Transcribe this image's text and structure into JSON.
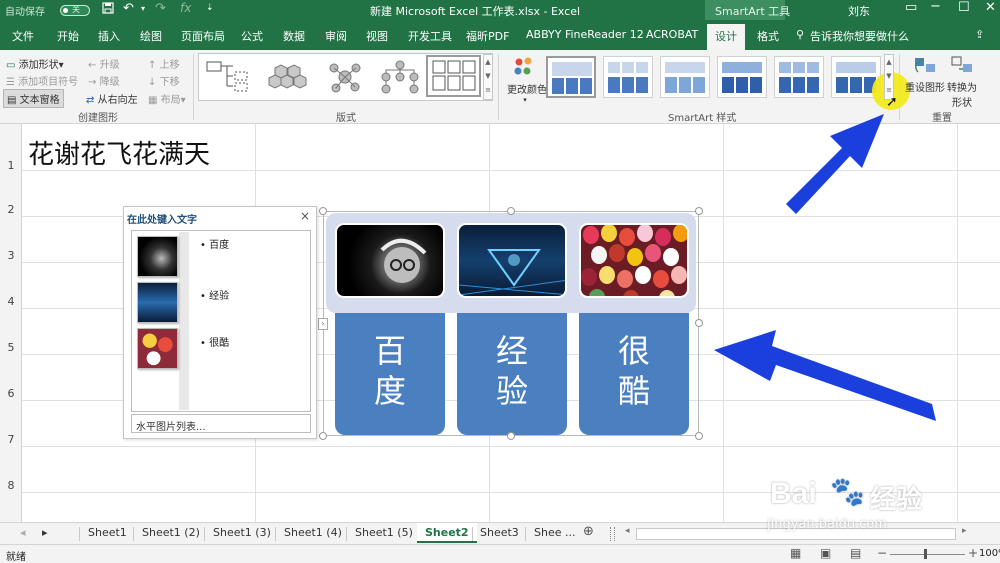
{
  "titlebar": {
    "autosave_label": "自动保存",
    "autosave_state": "关",
    "document_title": "新建 Microsoft Excel 工作表.xlsx  -  Excel",
    "contextual_tool": "SmartArt 工具",
    "user_name": "刘东",
    "qa_fx": "fx"
  },
  "tabs": [
    "文件",
    "开始",
    "插入",
    "绘图",
    "页面布局",
    "公式",
    "数据",
    "审阅",
    "视图",
    "开发工具",
    "福昕PDF",
    "ABBYY FineReader 12",
    "ACROBAT",
    "设计",
    "格式"
  ],
  "tell_me": "告诉我你想要做什么",
  "ribbon": {
    "create_graphic": {
      "label": "创建图形",
      "add_shape": "添加形状",
      "add_bullet": "添加项目符号",
      "text_pane": "文本窗格",
      "promote": "升级",
      "demote": "降级",
      "right_to_left": "从右向左",
      "move_up": "上移",
      "move_down": "下移",
      "layout": "布局"
    },
    "layouts_label": "版式",
    "change_colors": "更改颜色",
    "styles_label": "SmartArt 样式",
    "reset": {
      "label": "重置",
      "reset_graphic": "重设图形",
      "convert_line1": "转换为",
      "convert_line2": "形状"
    }
  },
  "sheet": {
    "row_numbers": [
      "1",
      "2",
      "3",
      "4",
      "5",
      "6",
      "7",
      "8"
    ],
    "a1_text": "花谢花飞花满天"
  },
  "text_pane": {
    "title": "在此处键入文字",
    "close": "×",
    "items": [
      "百度",
      "经验",
      "很酷"
    ],
    "footer": "水平图片列表..."
  },
  "smartart": {
    "labels_line1": [
      "百",
      "经",
      "很"
    ],
    "labels_line2": [
      "度",
      "验",
      "酷"
    ]
  },
  "sheet_tabs": [
    "Sheet1",
    "Sheet1 (2)",
    "Sheet1 (3)",
    "Sheet1 (4)",
    "Sheet1 (5)",
    "Sheet2",
    "Sheet3",
    "Shee ..."
  ],
  "active_sheet": "Sheet2",
  "status": {
    "ready": "就绪",
    "zoom": "100%"
  },
  "watermark": {
    "brand": "Bai",
    "brand2": "经验",
    "url": "jingyan.baidu.com"
  },
  "colors": {
    "excel_green": "#217346",
    "smartart_blue": "#4a7fc0",
    "arrow_blue": "#1a3fdd",
    "highlight_yellow": "#f2ea1f"
  }
}
